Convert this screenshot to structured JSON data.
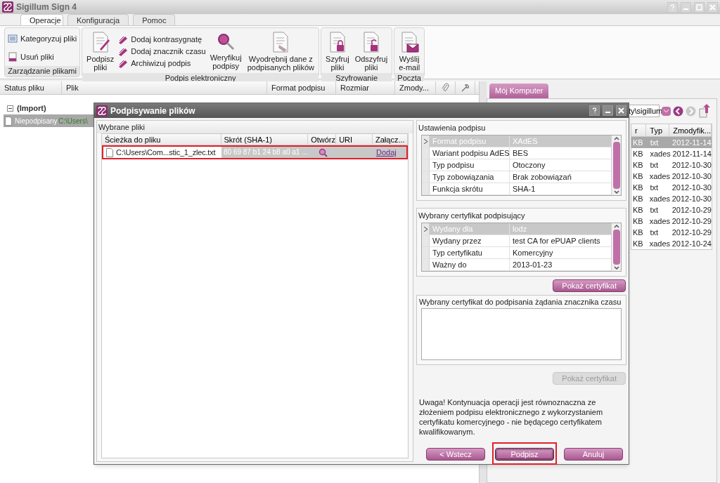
{
  "window": {
    "title": "Sigillum Sign 4"
  },
  "tabs": [
    {
      "label": "Operacje",
      "selected": true
    },
    {
      "label": "Konfiguracja",
      "selected": false
    },
    {
      "label": "Pomoc",
      "selected": false
    }
  ],
  "ribbon": {
    "groups": [
      {
        "label": "Zarządzanie plikami",
        "items": [
          {
            "kind": "small",
            "label": "Kategoryzuj pliki"
          },
          {
            "kind": "small",
            "label": "Usuń pliki"
          }
        ]
      },
      {
        "label": "Podpis elektroniczny",
        "items": [
          {
            "kind": "large",
            "label": "Podpisz\npliki"
          },
          {
            "kind": "small",
            "label": "Dodaj kontrasygnatę"
          },
          {
            "kind": "small",
            "label": "Dodaj znacznik czasu"
          },
          {
            "kind": "small",
            "label": "Archiwizuj podpis"
          },
          {
            "kind": "large",
            "label": "Weryfikuj\npodpisy"
          },
          {
            "kind": "large",
            "label": "Wyodrębnij dane z\npodpisanych plików"
          }
        ]
      },
      {
        "label": "Szyfrowanie",
        "items": [
          {
            "kind": "large",
            "label": "Szyfruj\npliki"
          },
          {
            "kind": "large",
            "label": "Odszyfruj\npliki"
          }
        ]
      },
      {
        "label": "Poczta",
        "items": [
          {
            "kind": "large",
            "label": "Wyślij\ne-mail"
          }
        ]
      }
    ]
  },
  "files_table": {
    "columns": [
      "Status pliku",
      "Plik",
      "Format podpisu",
      "Rozmiar",
      "Zmody..."
    ],
    "groups": [
      {
        "label": "(Import)",
        "expanded": true,
        "rows": [
          {
            "status": "Niepodpisany",
            "file": "C:\\Users\\",
            "selected": true
          }
        ]
      }
    ]
  },
  "browser": {
    "tab": "Mój Komputer",
    "path": "ty\\sigillum",
    "columns": [
      "r",
      "Typ",
      "Zmodyfik..."
    ],
    "rows": [
      {
        "size": "KB",
        "type": "txt",
        "modified": "2012-11-14",
        "selected": true
      },
      {
        "size": "KB",
        "type": "xades",
        "modified": "2012-11-14",
        "selected": false
      },
      {
        "size": "KB",
        "type": "txt",
        "modified": "2012-10-30",
        "selected": false
      },
      {
        "size": "KB",
        "type": "xades",
        "modified": "2012-10-30",
        "selected": false
      },
      {
        "size": "KB",
        "type": "txt",
        "modified": "2012-10-30",
        "selected": false
      },
      {
        "size": "KB",
        "type": "xades",
        "modified": "2012-10-30",
        "selected": false
      },
      {
        "size": "KB",
        "type": "txt",
        "modified": "2012-10-29",
        "selected": false
      },
      {
        "size": "KB",
        "type": "xades",
        "modified": "2012-10-29",
        "selected": false
      },
      {
        "size": "KB",
        "type": "txt",
        "modified": "2012-10-29",
        "selected": false
      },
      {
        "size": "KB",
        "type": "xades",
        "modified": "2012-10-24",
        "selected": false
      }
    ]
  },
  "dialog": {
    "title": "Podpisywanie plików",
    "files": {
      "title": "Wybrane pliki",
      "columns": [
        "Ścieżka do pliku",
        "Skrót (SHA-1)",
        "Otwórz",
        "URI",
        "Załącz..."
      ],
      "rows": [
        {
          "path": "C:\\Users\\Com...stic_1_zlec.txt",
          "hash": "80 69 87 b1 24 b8 a0 a1 ...",
          "attach": "Dodaj",
          "selected": true,
          "highlighted": true
        }
      ]
    },
    "settings": {
      "title": "Ustawienia podpisu",
      "rows": [
        {
          "name": "Format podpisu",
          "value": "XAdES",
          "selected": true
        },
        {
          "name": "Wariant podpisu AdES",
          "value": "BES",
          "selected": false
        },
        {
          "name": "Typ podpisu",
          "value": "Otoczony",
          "selected": false
        },
        {
          "name": "Typ zobowiązania",
          "value": "Brak zobowiązań",
          "selected": false
        },
        {
          "name": "Funkcja skrótu",
          "value": "SHA-1",
          "selected": false
        }
      ]
    },
    "certificate": {
      "title": "Wybrany certyfikat podpisujący",
      "rows": [
        {
          "name": "Wydany dla",
          "value": "lodz",
          "selected": true
        },
        {
          "name": "Wydany przez",
          "value": "test CA for ePUAP clients",
          "selected": false
        },
        {
          "name": "Typ certyfikatu",
          "value": "Komercyjny",
          "selected": false
        },
        {
          "name": "Ważny do",
          "value": "2013-01-23",
          "selected": false
        }
      ],
      "button": {
        "label": "Pokaż certyfikat",
        "disabled": false
      }
    },
    "timestamp_certificate": {
      "title": "Wybrany certyfikat do podpisania żądania znacznika czasu",
      "button": {
        "label": "Pokaż certyfikat",
        "disabled": true
      }
    },
    "warning": "Uwaga! Kontynuacja operacji jest równoznaczna ze złożeniem podpisu elektronicznego z wykorzystaniem certyfikatu komercyjnego - nie będącego certyfikatem kwalifikowanym.",
    "buttons": [
      {
        "label": "< Wstecz",
        "highlighted": false
      },
      {
        "label": "Podpisz",
        "highlighted": true
      },
      {
        "label": "Anuluj",
        "highlighted": false
      }
    ]
  }
}
